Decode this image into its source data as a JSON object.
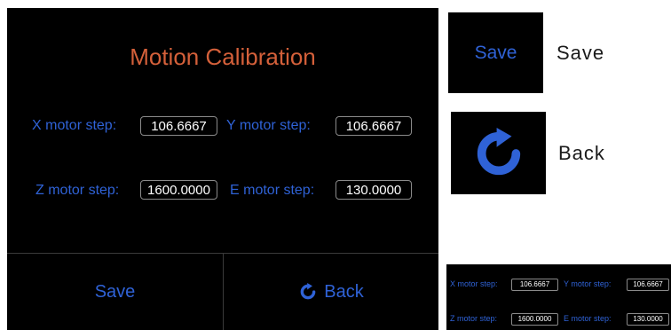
{
  "panel": {
    "title": "Motion Calibration",
    "fields": [
      {
        "label": "X motor step:",
        "value": "106.6667"
      },
      {
        "label": "Y motor step:",
        "value": "106.6667"
      },
      {
        "label": "Z motor step:",
        "value": "1600.0000"
      },
      {
        "label": "E motor step:",
        "value": "130.0000"
      }
    ],
    "buttons": {
      "save": "Save",
      "back": "Back"
    }
  },
  "reference": {
    "save_tile_label": "Save",
    "save_caption": "Save",
    "back_caption": "Back"
  },
  "colors": {
    "title": "#d4603a",
    "label": "#2f62d6",
    "value_text": "#ffffff",
    "background": "#000000"
  },
  "icons": {
    "back": "refresh-arrow-icon"
  }
}
